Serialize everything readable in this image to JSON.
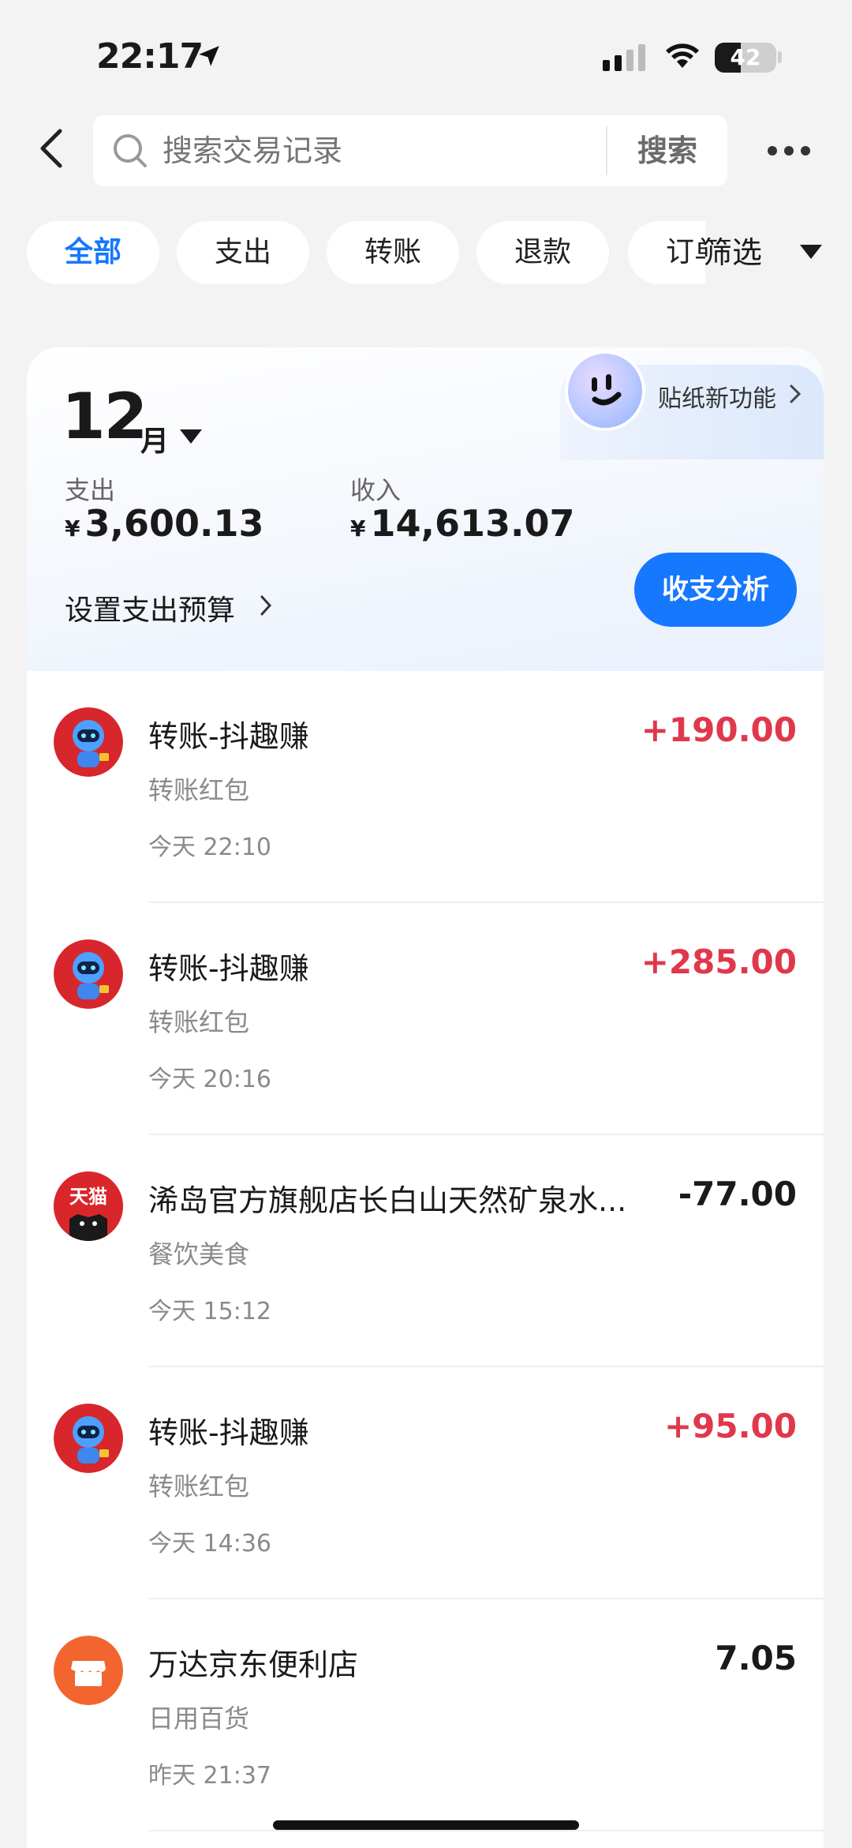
{
  "status_bar": {
    "time": "22:17",
    "battery": "42",
    "battery_level": 0.42
  },
  "search": {
    "placeholder": "搜索交易记录",
    "button": "搜索"
  },
  "tabs": [
    {
      "label": "全部",
      "active": true
    },
    {
      "label": "支出",
      "active": false
    },
    {
      "label": "转账",
      "active": false
    },
    {
      "label": "退款",
      "active": false
    },
    {
      "label": "订单",
      "active": false
    }
  ],
  "filter": {
    "label": "筛选"
  },
  "sticker": {
    "label": "贴纸新功能"
  },
  "summary": {
    "month": "12",
    "month_unit": "月",
    "expense_label": "支出",
    "expense_currency": "¥",
    "expense_value": "3,600.13",
    "income_label": "收入",
    "income_currency": "¥",
    "income_value": "14,613.07",
    "budget_link": "设置支出预算",
    "analysis_button": "收支分析"
  },
  "transactions": [
    {
      "title": "转账-抖趣赚",
      "subtitle": "转账红包",
      "time": "今天 22:10",
      "amount": "+190.00",
      "type": "income",
      "icon": "robot-icon"
    },
    {
      "title": "转账-抖趣赚",
      "subtitle": "转账红包",
      "time": "今天 20:16",
      "amount": "+285.00",
      "type": "income",
      "icon": "robot-icon"
    },
    {
      "title": "浠岛官方旗舰店长白山天然矿泉水...",
      "subtitle": "餐饮美食",
      "time": "今天 15:12",
      "amount": "-77.00",
      "type": "expense",
      "icon": "tmall-icon",
      "icon_text": "天猫"
    },
    {
      "title": "转账-抖趣赚",
      "subtitle": "转账红包",
      "time": "今天 14:36",
      "amount": "+95.00",
      "type": "income",
      "icon": "robot-icon"
    },
    {
      "title": "万达京东便利店",
      "subtitle": "日用百货",
      "time": "昨天 21:37",
      "amount": "7.05",
      "type": "expense",
      "icon": "store-icon"
    }
  ],
  "colors": {
    "accent": "#1677ff",
    "income": "#e0384b",
    "expense": "#1a1a1a",
    "tmall_red": "#d9262b",
    "store_orange": "#f2652f"
  }
}
